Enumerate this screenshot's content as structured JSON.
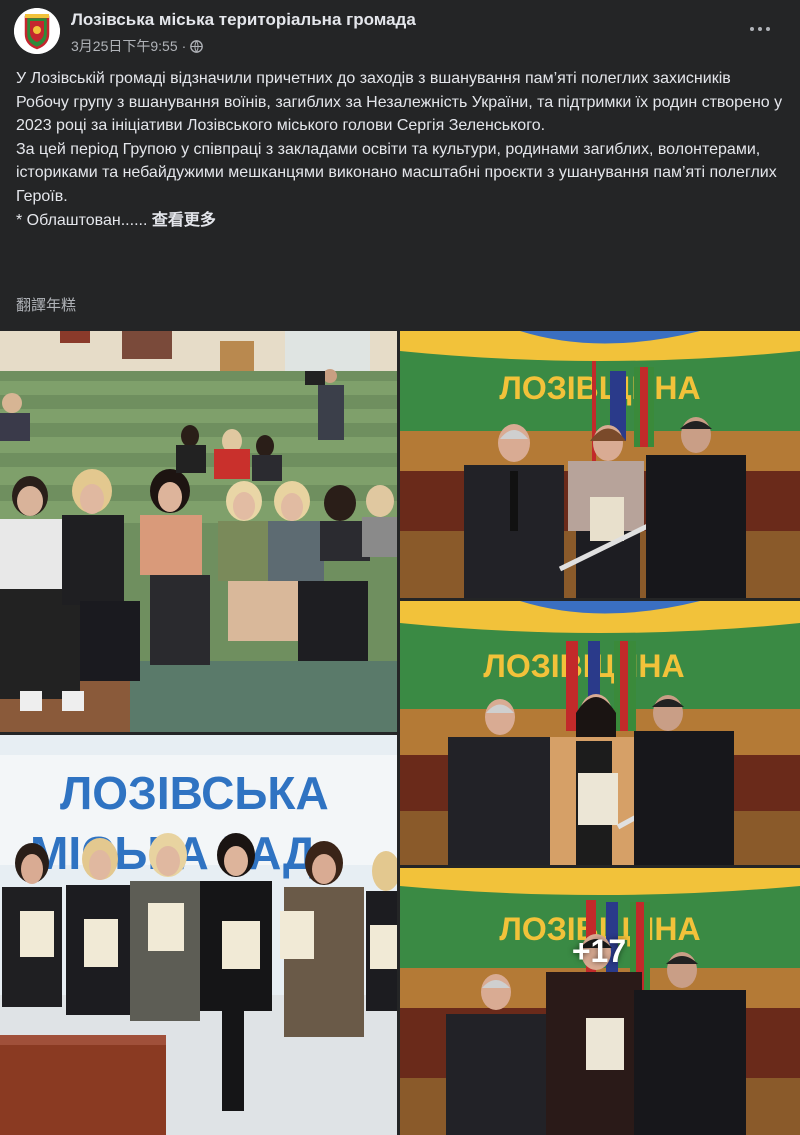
{
  "post": {
    "page_name": "Лозівська міська територіальна громада",
    "timestamp": "3月25日下午9:55",
    "separator": "·",
    "audience_icon": "globe-icon",
    "paragraphs": [
      "У Лозівській громаді відзначили причетних до заходів з вшанування пам’яті полеглих захисників",
      "Робочу групу з вшанування воїнів, загиблих за Незалежність України, та підтримки їх родин створено у 2023 році за ініціативи Лозівського міського голови Сергія Зеленського.",
      "За цей період Групою у співпраці з закладами освіти та культури, родинами загиблих, волонтерами, істориками та небайдужими мешканцями виконано масштабні проєкти з ушанування пам’яті полеглих Героїв."
    ],
    "truncated_text": "* Облаштован......",
    "see_more": "查看更多",
    "translate": "翻譯年糕"
  },
  "gallery": {
    "photos": [
      {
        "name": "photo-audience-hall"
      },
      {
        "name": "photo-award-1",
        "banner": "ЛОЗІВЩИНА"
      },
      {
        "name": "photo-award-2",
        "banner": "ЛОЗІВЩИНА"
      },
      {
        "name": "photo-group-women",
        "banner_line1": "ЛОЗІВСЬКА",
        "banner_line2": "МІСЬКА РАД"
      },
      {
        "name": "photo-award-3",
        "banner": "ЛОЗІВЩИНА"
      }
    ],
    "more_count": "+17"
  },
  "colors": {
    "background": "#242526",
    "text_primary": "#e4e6eb",
    "text_secondary": "#b0b3b8",
    "banner_green": "#3f8a3e",
    "banner_text": "#f2c23a",
    "blue_text": "#2f73c2"
  }
}
